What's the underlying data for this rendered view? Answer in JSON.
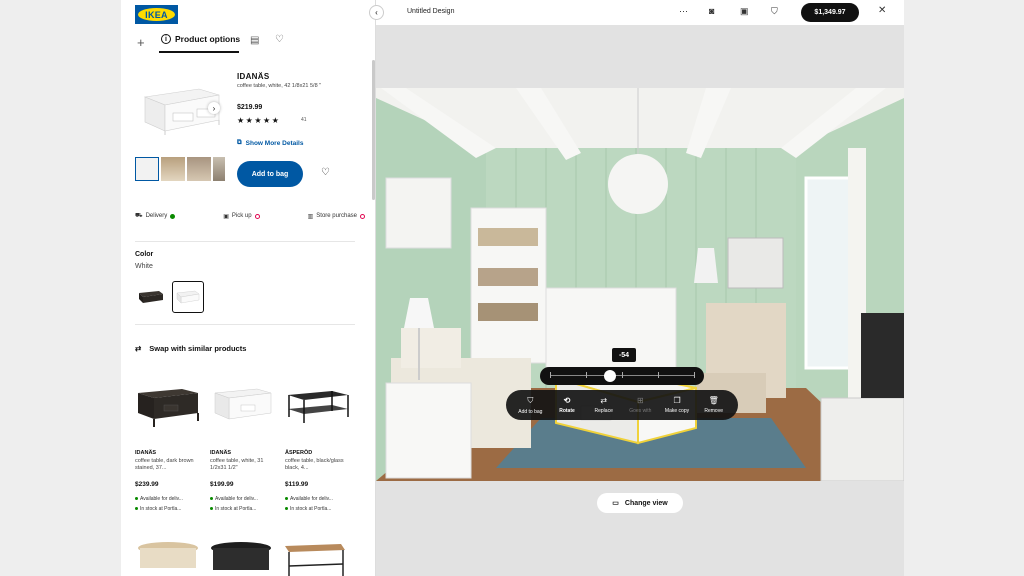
{
  "header": {
    "logo_text": "IKEA",
    "design_title": "Untitled Design",
    "cart_total": "$1,349.97",
    "tabs": {
      "options_label": "Product options"
    },
    "icons": [
      "more-icon",
      "camera-icon",
      "save-icon",
      "basket-icon",
      "close-icon"
    ]
  },
  "product": {
    "name": "IDANÄS",
    "description": "coffee table, white, 42 1/8x21 5/8 \"",
    "price": "$219.99",
    "stars": "★★★★★",
    "reviews": "41",
    "details_link": "Show More Details",
    "add_to_bag": "Add to bag"
  },
  "fulfillment": [
    {
      "label": "Delivery",
      "status": "available"
    },
    {
      "label": "Pick up",
      "status": "unavailable"
    },
    {
      "label": "Store purchase",
      "status": "unavailable"
    }
  ],
  "color": {
    "label": "Color",
    "value": "White"
  },
  "swap": {
    "label": "Swap with similar products"
  },
  "similar": [
    {
      "name": "IDANÄS",
      "desc": "coffee table, dark brown stained, 37...",
      "price": "$239.99",
      "avail": "Available for deliv...",
      "stock": "In stock at Portla..."
    },
    {
      "name": "IDANÄS",
      "desc": "coffee table, white, 31 1/2x31 1/2\"",
      "price": "$199.99",
      "avail": "Available for deliv...",
      "stock": "In stock at Portla..."
    },
    {
      "name": "ÅSPERÖD",
      "desc": "coffee table, black/glass black, 4...",
      "price": "$119.99",
      "avail": "Available for deliv...",
      "stock": "In stock at Portla..."
    }
  ],
  "canvas": {
    "rotation_value": "-54",
    "rotation_fraction": 0.42,
    "actions": [
      {
        "label": "Add to bag",
        "icon": "basket-icon",
        "state": "normal"
      },
      {
        "label": "Rotate",
        "icon": "rotate-icon",
        "state": "active"
      },
      {
        "label": "Replace",
        "icon": "swap-icon",
        "state": "normal"
      },
      {
        "label": "Goes with",
        "icon": "goes-with-icon",
        "state": "disabled"
      },
      {
        "label": "Make copy",
        "icon": "copy-icon",
        "state": "normal"
      },
      {
        "label": "Remove",
        "icon": "trash-icon",
        "state": "normal"
      }
    ],
    "change_view": "Change view"
  },
  "colors": {
    "brand_blue": "#0058a3",
    "brand_yellow": "#ffdb00",
    "available_green": "#0a8a00",
    "unavailable_red": "#e00751"
  }
}
